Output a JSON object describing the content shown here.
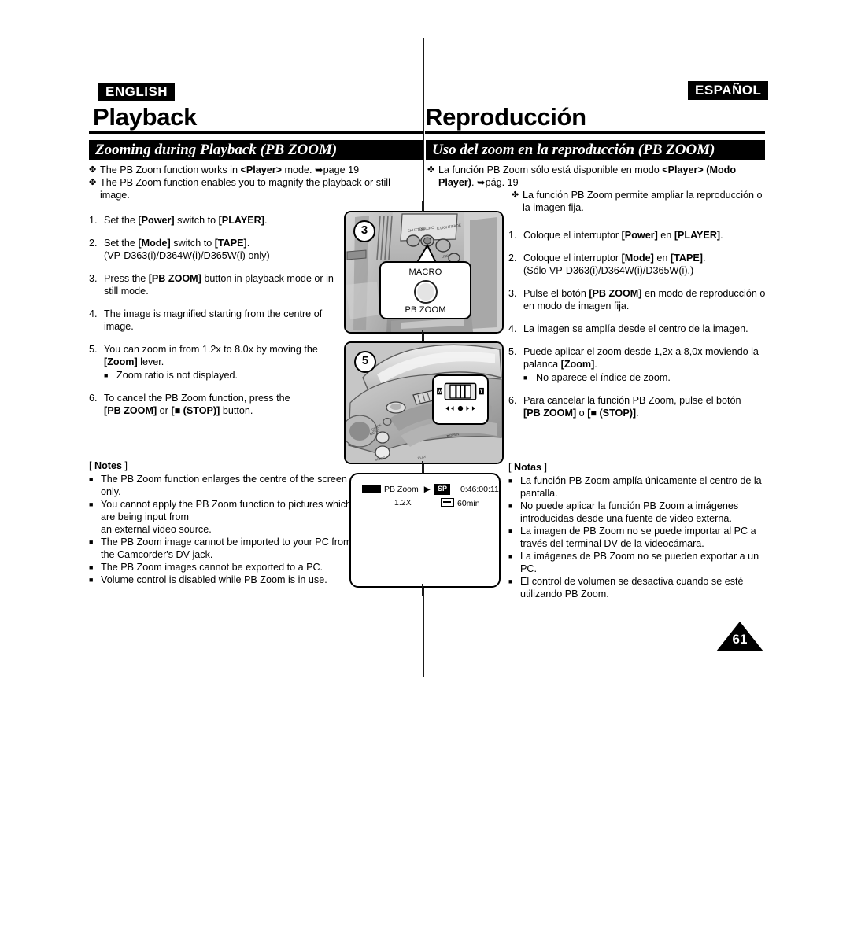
{
  "meta": {
    "page_number": "61"
  },
  "english": {
    "lang_badge": "ENGLISH",
    "chapter_title": "Playback",
    "section_banner": "Zooming during Playback (PB ZOOM)",
    "bullet_marker": "✤",
    "square_marker": "■",
    "intro_bullets": [
      "The PB Zoom function works in <Player> mode. ➥page 19",
      "The PB Zoom function enables you to magnify the playback or still image."
    ],
    "steps": [
      {
        "num": "1.",
        "text": "Set the [Power] switch to [PLAYER]."
      },
      {
        "num": "2.",
        "text": "Set the [Mode] switch to [TAPE]. (VP-D363(i)/D364W(i)/D365W(i) only)"
      },
      {
        "num": "3.",
        "text": "Press the [PB ZOOM] button in playback mode or in still mode."
      },
      {
        "num": "4.",
        "text": "The image is magnified starting from the centre of image."
      },
      {
        "num": "5.",
        "text": "You can zoom in from 1.2x to 8.0x by moving the [Zoom] lever.",
        "sub": "Zoom ratio is not displayed."
      },
      {
        "num": "6.",
        "text": "To cancel the PB Zoom function, press the [PB ZOOM] or [■ (STOP)] button."
      }
    ],
    "notes_title": "[ Notes ]",
    "notes": [
      "The PB Zoom function enlarges the centre of the screen only.",
      "You cannot apply the PB Zoom function to pictures which are being input from an external video source.",
      "The PB Zoom image cannot be imported to your PC from the Camcorder's DV jack.",
      "The PB Zoom images cannot be exported to a PC.",
      "Volume control is disabled while PB Zoom is in use."
    ]
  },
  "spanish": {
    "lang_badge": "ESPAÑOL",
    "chapter_title": "Reproducción",
    "section_banner": "Uso del zoom en la reproducción (PB ZOOM)",
    "bullet_marker": "✤",
    "square_marker": "■",
    "intro_bullets": [
      "La función PB Zoom sólo está disponible en modo <Player> (Modo Player). ➥pág. 19",
      "La función PB Zoom permite ampliar la reproducción o la imagen fija."
    ],
    "steps": [
      {
        "num": "1.",
        "text": "Coloque el interruptor [Power] en [PLAYER]."
      },
      {
        "num": "2.",
        "text": "Coloque el interruptor [Mode] en [TAPE]. (Sólo VP-D363(i)/D364W(i)/D365W(i).)"
      },
      {
        "num": "3.",
        "text": "Pulse el botón [PB ZOOM] en modo de reproducción o en modo de imagen fija."
      },
      {
        "num": "4.",
        "text": "La imagen se amplía desde el centro de la imagen."
      },
      {
        "num": "5.",
        "text": "Puede aplicar el zoom desde 1,2x a 8,0x moviendo la palanca [Zoom].",
        "sub": "No aparece el índice de zoom."
      },
      {
        "num": "6.",
        "text": "Para cancelar la función PB Zoom, pulse el botón [PB ZOOM] o [■ (STOP)]."
      }
    ],
    "notes_title": "[ Notas ]",
    "notes": [
      "La función PB Zoom amplía únicamente el centro de la pantalla.",
      "No puede aplicar la función PB Zoom a imágenes introducidas desde una fuente de video externa.",
      "La imagen de PB Zoom no se puede importar al PC a través del terminal DV de la videocámara.",
      "La imágenes de PB Zoom no se pueden exportar a un PC.",
      "El control de volumen se desactiva cuando se esté utilizando PB Zoom."
    ]
  },
  "illustrations": {
    "fig3": {
      "step_number": "3",
      "callout_top_label": "MACRO",
      "callout_bottom_label": "PB ZOOM"
    },
    "fig5": {
      "step_number": "5",
      "zoom_wide_label": "W",
      "zoom_tele_label": "T"
    },
    "lcd": {
      "mode_label": "PB Zoom",
      "play_indicator": "▶",
      "zoom_ratio": "1.2X",
      "record_mode": "SP",
      "timecode": "0:46:00:11",
      "tape_remaining": "60min"
    }
  }
}
